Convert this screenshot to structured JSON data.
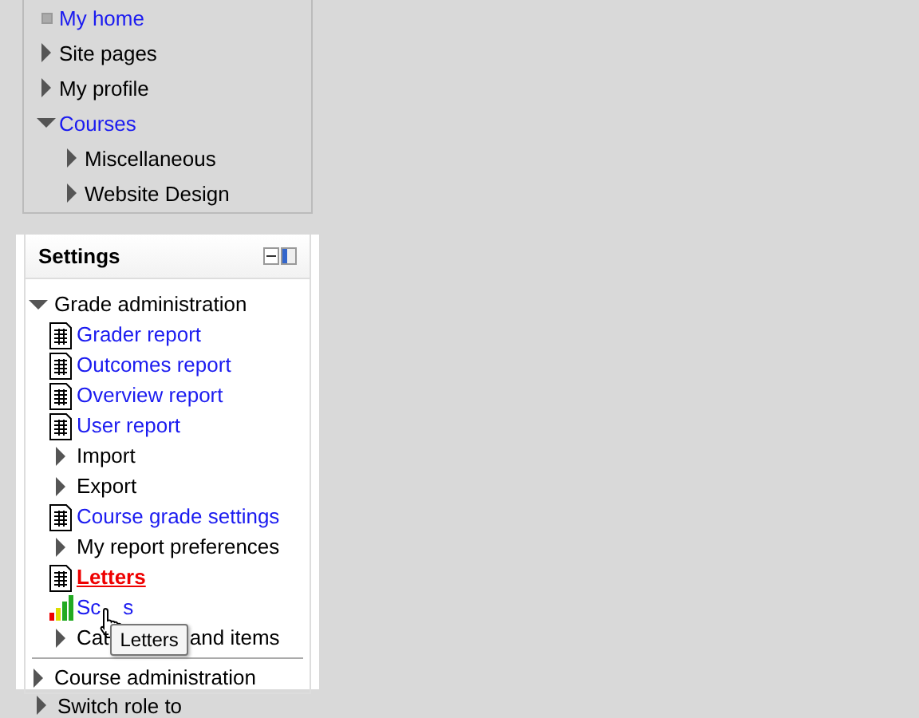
{
  "navigation": {
    "items": [
      {
        "label": "My home",
        "kind": "leaf",
        "link": true
      },
      {
        "label": "Site pages",
        "kind": "branch",
        "expanded": false,
        "link": false
      },
      {
        "label": "My profile",
        "kind": "branch",
        "expanded": false,
        "link": false
      },
      {
        "label": "Courses",
        "kind": "branch",
        "expanded": true,
        "link": true,
        "children": [
          {
            "label": "Miscellaneous",
            "kind": "branch",
            "expanded": false,
            "link": false
          },
          {
            "label": "Website Design",
            "kind": "branch",
            "expanded": false,
            "link": false
          }
        ]
      }
    ]
  },
  "settings": {
    "title": "Settings",
    "items": [
      {
        "label": "Grade administration",
        "kind": "branch",
        "expanded": true,
        "link": false,
        "children": [
          {
            "label": "Grader report",
            "kind": "report",
            "link": true,
            "active": false
          },
          {
            "label": "Outcomes report",
            "kind": "report",
            "link": true,
            "active": false
          },
          {
            "label": "Overview report",
            "kind": "report",
            "link": true,
            "active": false
          },
          {
            "label": "User report",
            "kind": "report",
            "link": true,
            "active": false
          },
          {
            "label": "Import",
            "kind": "branch",
            "expanded": false,
            "link": false
          },
          {
            "label": "Export",
            "kind": "branch",
            "expanded": false,
            "link": false
          },
          {
            "label": "Course grade settings",
            "kind": "report",
            "link": true,
            "active": false
          },
          {
            "label": "My report preferences",
            "kind": "branch",
            "expanded": false,
            "link": false
          },
          {
            "label": "Letters",
            "kind": "report",
            "link": true,
            "active": true
          },
          {
            "label": "Sc",
            "label_after": "s",
            "kind": "chart",
            "link": true,
            "active": false,
            "pointer": true
          },
          {
            "label": "Cat",
            "label_after": "and items",
            "kind": "branch",
            "expanded": false,
            "link": false,
            "tooltip": "Letters"
          }
        ]
      },
      {
        "label": "Course administration",
        "kind": "branch",
        "expanded": false,
        "link": false,
        "divider": true
      }
    ]
  },
  "next_block": {
    "items": [
      {
        "label": "Switch role to",
        "kind": "branch",
        "expanded": false,
        "link": false
      }
    ]
  }
}
